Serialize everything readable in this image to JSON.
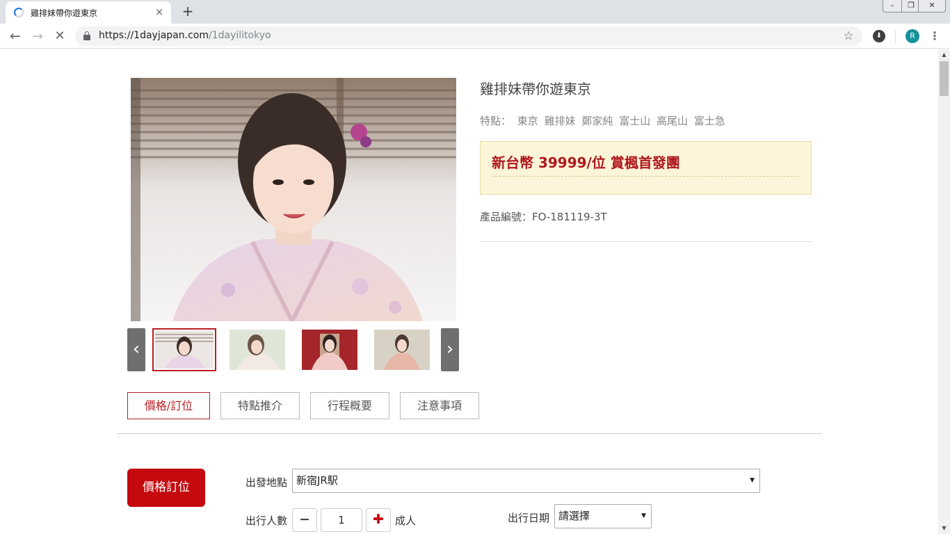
{
  "browser": {
    "tab_title": "雞排妹帶你遊東京",
    "tab_close": "×",
    "new_tab": "+",
    "url_host": "https://1dayjapan.com",
    "url_path": "/1dayilitokyo",
    "avatar_initial": "R",
    "window_controls": {
      "minimize": "–",
      "maximize": "❐",
      "close": "✕"
    }
  },
  "product": {
    "title": "雞排妹帶你遊東京",
    "features_label": "特點：",
    "features": [
      "東京",
      "雞排妹",
      "鄭家純",
      "富士山",
      "高尾山",
      "富士急"
    ],
    "price": "新台幣 39999/位 賞楓首發團",
    "code": "產品編號：FO-181119-3T"
  },
  "gallery": {
    "prev": "‹",
    "next": "›",
    "thumbnails": 4,
    "selected_index": 0
  },
  "tabs": [
    {
      "label": "價格/訂位",
      "active": true
    },
    {
      "label": "特點推介",
      "active": false
    },
    {
      "label": "行程概要",
      "active": false
    },
    {
      "label": "注意事項",
      "active": false
    }
  ],
  "order": {
    "button": "價格訂位",
    "departure_label": "出發地點",
    "departure_value": "新宿JR駅",
    "people_label": "出行人數",
    "qty": "1",
    "minus": "−",
    "plus": "✚",
    "unit": "成人",
    "date_label": "出行日期",
    "date_value": "請選擇"
  },
  "colors": {
    "brand_red": "#c4090f",
    "price_red": "#b0191e",
    "price_box_bg": "#fcf5d9"
  }
}
